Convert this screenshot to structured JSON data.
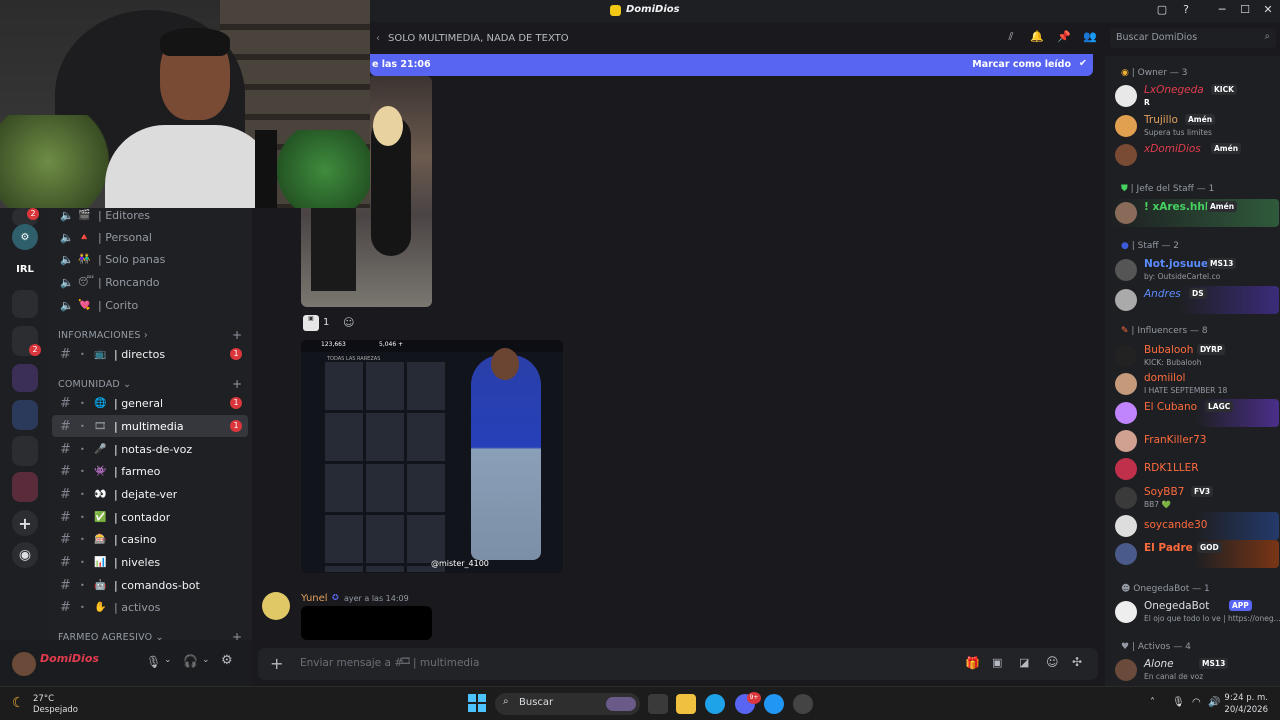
{
  "window": {
    "title": "DomiDios",
    "controls": [
      "▢",
      "?",
      "─",
      "☐",
      "✕"
    ]
  },
  "topbar": {
    "channel_topic": "SOLO MULTIMEDIA, NADA DE TEXTO",
    "search_placeholder": "Buscar DomiDios"
  },
  "new_messages_bar": {
    "text": "e las 21:06",
    "action": "Marcar como leído"
  },
  "sidebar": {
    "voice_channels": [
      {
        "emoji": "🎬",
        "label": "| Editores"
      },
      {
        "emoji": "🔺",
        "label": "| Personal"
      },
      {
        "emoji": "👫",
        "label": "| Solo panas"
      },
      {
        "emoji": "😴",
        "label": "| Roncando"
      },
      {
        "emoji": "💘",
        "label": "| Corito"
      }
    ],
    "categories": {
      "informaciones": "INFORMACIONES",
      "comunidad": "COMUNIDAD",
      "farmeo": "FARMEO AGRESIVO"
    },
    "info_channels": [
      {
        "emoji": "📺",
        "label": "| directos",
        "unread": "1"
      }
    ],
    "community_channels": [
      {
        "emoji": "🌐",
        "label": "| general",
        "unread": "1"
      },
      {
        "emoji": "🎞",
        "label": "| multimedia",
        "unread": "1"
      },
      {
        "emoji": "🎤",
        "label": "| notas-de-voz"
      },
      {
        "emoji": "👾",
        "label": "| farmeo"
      },
      {
        "emoji": "👀",
        "label": "| dejate-ver"
      },
      {
        "emoji": "✅",
        "label": "| contador"
      },
      {
        "emoji": "🎰",
        "label": "| casino"
      },
      {
        "emoji": "📊",
        "label": "| niveles"
      },
      {
        "emoji": "🤖",
        "label": "| comandos-bot"
      },
      {
        "emoji": "✋",
        "label": "| activos"
      }
    ],
    "guild_badges": {
      "top": "2",
      "mid": "2"
    },
    "guild_labels": {
      "irl": "IRL"
    }
  },
  "user_panel": {
    "username": "DomiDios"
  },
  "messages": {
    "reaction_count": "1",
    "author": "Yunel",
    "timestamp": "ayer a las 14:09",
    "image_caption": "@mister_4100",
    "game_stats": [
      "123,663",
      "5,046 +"
    ],
    "game_header": "TODAS LAS RAREZAS"
  },
  "composer": {
    "placeholder": "Enviar mensaje a #",
    "channel": "| multimedia"
  },
  "members": {
    "groups": [
      {
        "label": "| Owner — 3"
      },
      {
        "label": "| Jefe del Staff — 1"
      },
      {
        "label": "| Staff — 2"
      },
      {
        "label": "| Influencers — 8"
      },
      {
        "label": "OnegedaBot — 1"
      },
      {
        "label": "| Activos — 4"
      }
    ],
    "list": [
      {
        "name": "LxOnegeda",
        "tag": "KICK",
        "sub": "R",
        "color": "#e03c4e"
      },
      {
        "name": "Trujillo",
        "tag": "Amén",
        "sub": "Supera tus limites",
        "color": "#e0a060"
      },
      {
        "name": "xDomiDios",
        "tag": "Amén",
        "sub": "",
        "color": "#e03c4e"
      },
      {
        "name": "! xAres.hhh",
        "tag": "Amén",
        "sub": "",
        "color": "#46d160"
      },
      {
        "name": "Not.josuue",
        "tag": "MS13",
        "sub": "by: OutsideCartel.co",
        "color": "#5b8cff"
      },
      {
        "name": "Andres",
        "tag": "DS",
        "sub": "",
        "color": "#5b8cff"
      },
      {
        "name": "Bubalooh",
        "tag": "DYRP",
        "sub": "KICK: Bubalooh",
        "color": "#ff6b3d"
      },
      {
        "name": "domiilol",
        "tag": "",
        "sub": "I HATE SEPTEMBER 18",
        "color": "#ff6b3d"
      },
      {
        "name": "El Cubano",
        "tag": "LAGC",
        "sub": "",
        "color": "#ff6b3d"
      },
      {
        "name": "FranKiller73",
        "tag": "",
        "sub": "",
        "color": "#ff6b3d"
      },
      {
        "name": "RDK1LLER",
        "tag": "",
        "sub": "",
        "color": "#ff6b3d"
      },
      {
        "name": "SoyBB7",
        "tag": "FV3",
        "sub": "BB7 💚",
        "color": "#ff6b3d"
      },
      {
        "name": "soycande30",
        "tag": "",
        "sub": "",
        "color": "#ff6b3d"
      },
      {
        "name": "El Padre",
        "tag": "GOD",
        "sub": "",
        "color": "#ff6b3d"
      },
      {
        "name": "OnegedaBot",
        "tag": "APP",
        "sub": "El ojo que todo lo ve | https://oneg...",
        "color": "#dbdee1"
      },
      {
        "name": "Alone",
        "tag": "MS13",
        "sub": "En canal de voz",
        "color": "#dbdee1"
      }
    ]
  },
  "taskbar": {
    "weather_temp": "27°C",
    "weather_text": "Despejado",
    "search": "Buscar",
    "time": "9:24 p. m.",
    "date": "20/4/2026",
    "discord_badge": "9+"
  },
  "colors": {
    "accent": "#5865f2",
    "danger": "#da373c",
    "online": "#23a55a"
  }
}
